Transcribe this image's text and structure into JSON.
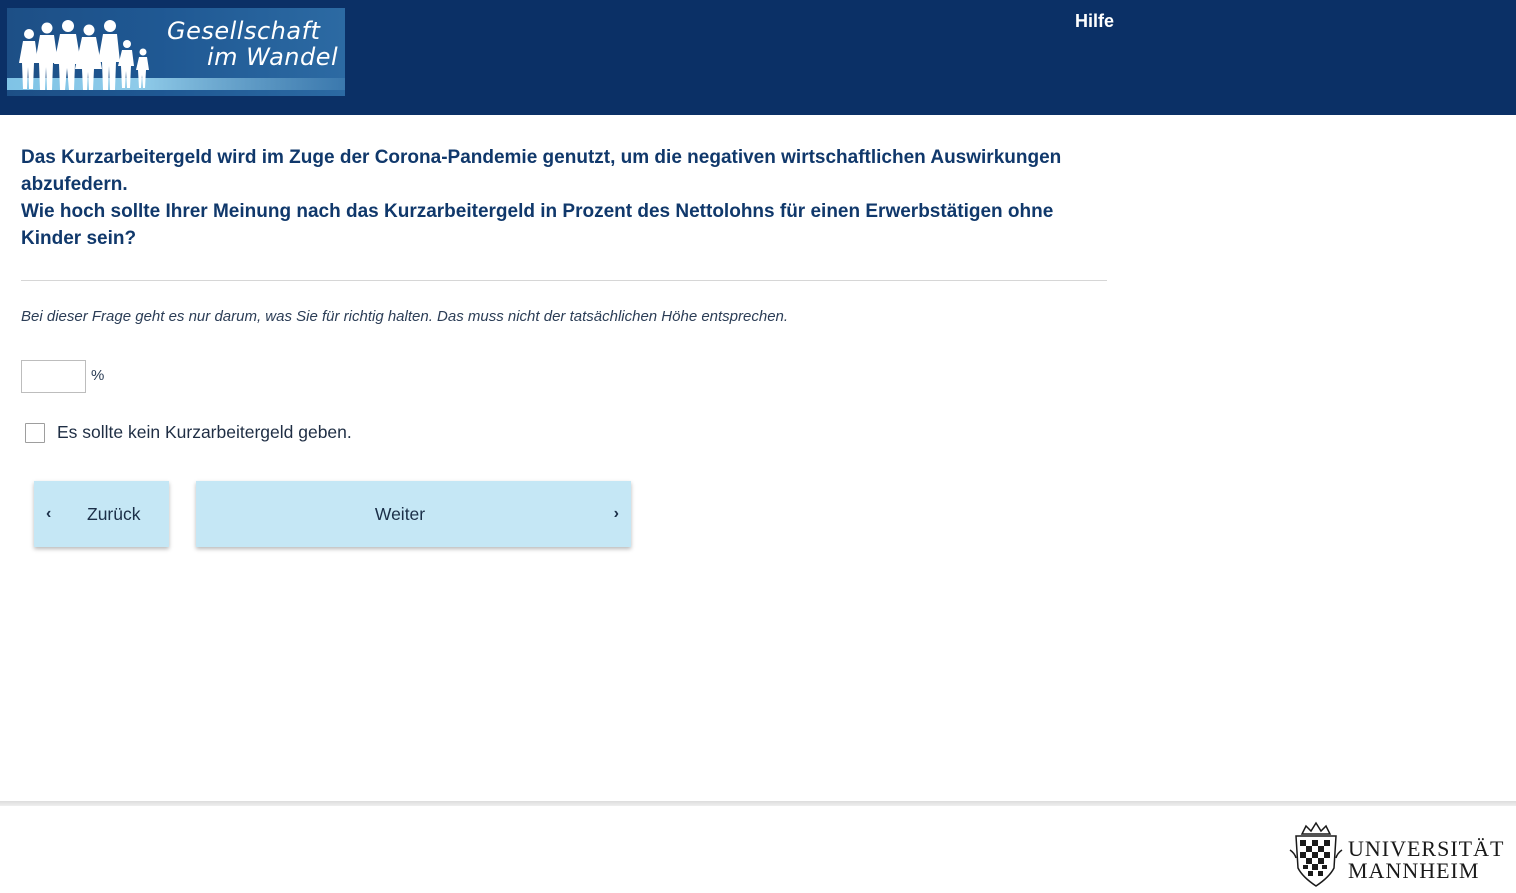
{
  "header": {
    "logo_line1": "Gesellschaft",
    "logo_line2": "im Wandel",
    "help_label": "Hilfe",
    "background_color": "#0b3066"
  },
  "question": {
    "line1": "Das Kurzarbeitergeld wird im Zuge der Corona-Pandemie genutzt, um die negativen wirtschaftlichen Auswirkungen abzufedern.",
    "line2": "Wie hoch sollte Ihrer Meinung nach das Kurzarbeitergeld in Prozent des Nettolohns für einen Erwerbstätigen ohne Kinder sein?",
    "color": "#10386b"
  },
  "hint": "Bei dieser Frage geht es nur darum, was Sie für richtig halten. Das muss nicht der tatsächlichen Höhe entsprechen.",
  "percent_input": {
    "value": "",
    "unit": "%"
  },
  "no_benefit_option": {
    "label": "Es sollte kein Kurzarbeitergeld geben.",
    "checked": false
  },
  "navigation": {
    "back_label": "Zurück",
    "back_icon": "chevron-left-icon",
    "next_label": "Weiter",
    "next_icon": "chevron-right-icon",
    "button_color": "#c5e7f5"
  },
  "footer": {
    "university_line1": "UNIVERSITÄT",
    "university_line2": "MANNHEIM"
  }
}
